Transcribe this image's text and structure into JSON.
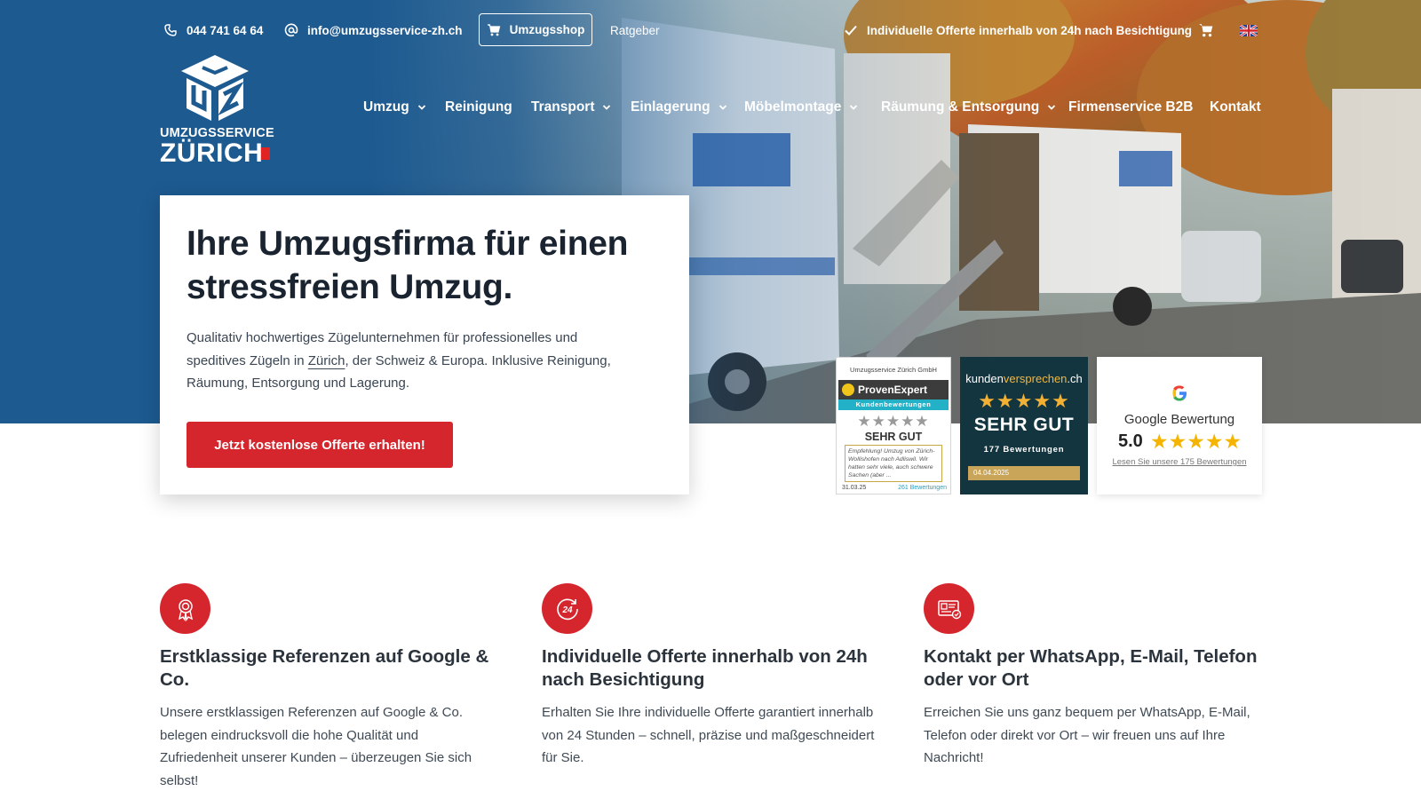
{
  "topbar": {
    "phone": "044 741 64 64",
    "email": "info@umzugsservice-zh.ch",
    "shop_label": "Umzugsshop",
    "guide_label": "Ratgeber",
    "offer_note": "Individuelle Offerte innerhalb von 24h nach Besichtigung",
    "icons": {
      "phone": "phone-icon",
      "email": "at-icon",
      "shop": "cart-icon",
      "check": "check-icon",
      "cart": "cart-icon",
      "language": "uk-flag-icon"
    }
  },
  "logo": {
    "line1": "UMZUGSSERVICE",
    "line2": "ZÜRICH"
  },
  "nav": {
    "items": [
      {
        "label": "Umzug",
        "has_dropdown": true
      },
      {
        "label": "Reinigung",
        "has_dropdown": false
      },
      {
        "label": "Transport",
        "has_dropdown": true
      },
      {
        "label": "Einlagerung",
        "has_dropdown": true
      },
      {
        "label": "Möbelmontage",
        "has_dropdown": true
      },
      {
        "label": "Räumung & Entsorgung",
        "has_dropdown": true
      },
      {
        "label": "Firmenservice B2B",
        "has_dropdown": false
      },
      {
        "label": "Kontakt",
        "has_dropdown": false
      }
    ]
  },
  "hero": {
    "headline": "Ihre Umzugsfirma für einen stressfreien Umzug.",
    "text_before": "Qualitativ hochwertiges Zügelunternehmen für professionelles und speditives Zügeln in ",
    "text_link": "Zürich",
    "text_after": ", der Schweiz & Europa. Inklusive Reinigung, Räumung, Entsorgung und Lagerung.",
    "cta_label": "Jetzt kostenlose Offerte erhalten!"
  },
  "badges": {
    "proven_expert": {
      "company": "Umzugsservice Zürich GmbH",
      "brand": "ProvenExpert",
      "subtitle": "Kundenbewertungen",
      "stars": "★★★★★",
      "rating_text": "SEHR GUT",
      "quote": "Empfehlung! Umzug von Zürich-Wollishofen nach Adliswil. Wir hatten sehr viele, auch schwere Sachen (aber ...",
      "date": "31.03.25",
      "count": "261 Bewertungen"
    },
    "kundenversprechen": {
      "brand_a": "kunden",
      "brand_b": "versprechen",
      "brand_c": ".ch",
      "stars": "★★★★★",
      "rating_text": "SEHR GUT",
      "count": "177 Bewertungen",
      "date": "04.04.2025"
    },
    "google": {
      "title": "Google Bewertung",
      "score": "5.0",
      "stars": "★★★★★",
      "link": "Lesen Sie unsere 175 Bewertungen"
    }
  },
  "features": [
    {
      "icon": "award-icon",
      "title": "Erstklassige Referenzen auf Google & Co.",
      "text": "Unsere erstklassigen Referenzen auf Google & Co. belegen eindrucksvoll die hohe Qualität und Zufriedenheit unserer Kunden – überzeugen Sie sich selbst!"
    },
    {
      "icon": "24h-icon",
      "title": "Individuelle Offerte innerhalb von 24h nach Besichtigung",
      "text": "Erhalten Sie Ihre individuelle Offerte garantiert innerhalb von 24 Stunden – schnell, präzise und maßgeschneidert für Sie."
    },
    {
      "icon": "contact-card-icon",
      "title": "Kontakt per WhatsApp, E-Mail, Telefon oder vor Ort",
      "text": "Erreichen Sie uns ganz bequem per WhatsApp, E-Mail, Telefon oder direkt vor Ort – wir freuen uns auf Ihre Nachricht!"
    }
  ],
  "colors": {
    "brand_blue": "#1d5a90",
    "accent_red": "#d6262d",
    "text_dark": "#1a2330"
  }
}
